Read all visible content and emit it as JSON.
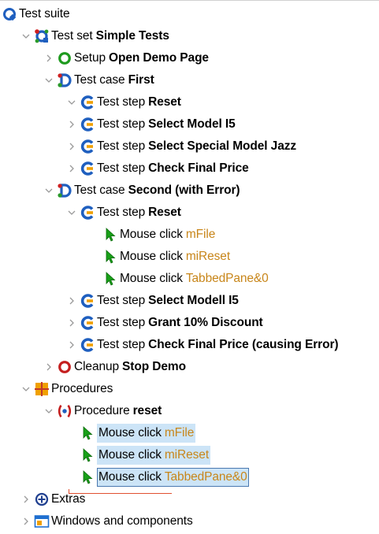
{
  "tree": {
    "nodes": [
      {
        "id": "n0",
        "level": 0,
        "expand": "none",
        "icon": "testsuite-icon",
        "kind": "Test suite",
        "name": "",
        "ref": "",
        "selected": false
      },
      {
        "id": "n1",
        "level": 1,
        "expand": "expanded",
        "icon": "testset-icon",
        "kind": "Test set",
        "name": "Simple Tests",
        "ref": "",
        "selected": false
      },
      {
        "id": "n2",
        "level": 2,
        "expand": "collapsed",
        "icon": "setup-icon",
        "kind": "Setup",
        "name": "Open Demo Page",
        "ref": "",
        "selected": false
      },
      {
        "id": "n3",
        "level": 2,
        "expand": "expanded",
        "icon": "testcase-icon",
        "kind": "Test case",
        "name": "First",
        "ref": "",
        "selected": false
      },
      {
        "id": "n4",
        "level": 3,
        "expand": "expanded",
        "icon": "teststep-icon",
        "kind": "Test step",
        "name": "Reset",
        "ref": "",
        "selected": false
      },
      {
        "id": "n5",
        "level": 3,
        "expand": "collapsed",
        "icon": "teststep-icon",
        "kind": "Test step",
        "name": "Select Model I5",
        "ref": "",
        "selected": false
      },
      {
        "id": "n6",
        "level": 3,
        "expand": "collapsed",
        "icon": "teststep-icon",
        "kind": "Test step",
        "name": "Select Special Model Jazz",
        "ref": "",
        "selected": false
      },
      {
        "id": "n7",
        "level": 3,
        "expand": "collapsed",
        "icon": "teststep-icon",
        "kind": "Test step",
        "name": "Check Final Price",
        "ref": "",
        "selected": false
      },
      {
        "id": "n8",
        "level": 2,
        "expand": "expanded",
        "icon": "testcase-icon",
        "kind": "Test case",
        "name": "Second (with Error)",
        "ref": "",
        "selected": false
      },
      {
        "id": "n9",
        "level": 3,
        "expand": "expanded",
        "icon": "teststep-icon",
        "kind": "Test step",
        "name": "Reset",
        "ref": "",
        "selected": false
      },
      {
        "id": "n10",
        "level": 4,
        "expand": "none",
        "icon": "mouse-click-icon",
        "kind": "Mouse click",
        "name": "",
        "ref": "mFile",
        "selected": false
      },
      {
        "id": "n11",
        "level": 4,
        "expand": "none",
        "icon": "mouse-click-icon",
        "kind": "Mouse click",
        "name": "",
        "ref": "miReset",
        "selected": false
      },
      {
        "id": "n12",
        "level": 4,
        "expand": "none",
        "icon": "mouse-click-icon",
        "kind": "Mouse click",
        "name": "",
        "ref": "TabbedPane&0",
        "selected": false
      },
      {
        "id": "n13",
        "level": 3,
        "expand": "collapsed",
        "icon": "teststep-icon",
        "kind": "Test step",
        "name": "Select Modell I5",
        "ref": "",
        "selected": false
      },
      {
        "id": "n14",
        "level": 3,
        "expand": "collapsed",
        "icon": "teststep-icon",
        "kind": "Test step",
        "name": "Grant 10% Discount",
        "ref": "",
        "selected": false
      },
      {
        "id": "n15",
        "level": 3,
        "expand": "collapsed",
        "icon": "teststep-icon",
        "kind": "Test step",
        "name": "Check Final Price (causing Error)",
        "ref": "",
        "selected": false
      },
      {
        "id": "n16",
        "level": 2,
        "expand": "collapsed",
        "icon": "cleanup-icon",
        "kind": "Cleanup",
        "name": "Stop Demo",
        "ref": "",
        "selected": false
      },
      {
        "id": "n17",
        "level": 1,
        "expand": "expanded",
        "icon": "procedures-icon",
        "kind": "Procedures",
        "name": "",
        "ref": "",
        "selected": false
      },
      {
        "id": "n18",
        "level": 2,
        "expand": "expanded",
        "icon": "procedure-icon",
        "kind": "Procedure",
        "name": "reset",
        "ref": "",
        "selected": false
      },
      {
        "id": "n19",
        "level": 3,
        "expand": "none",
        "icon": "mouse-click-icon",
        "kind": "Mouse click",
        "name": "",
        "ref": "mFile",
        "selected": true
      },
      {
        "id": "n20",
        "level": 3,
        "expand": "none",
        "icon": "mouse-click-icon",
        "kind": "Mouse click",
        "name": "",
        "ref": "miReset",
        "selected": true
      },
      {
        "id": "n21",
        "level": 3,
        "expand": "none",
        "icon": "mouse-click-icon",
        "kind": "Mouse click",
        "name": "",
        "ref": "TabbedPane&0",
        "selected": true,
        "focused": true
      },
      {
        "id": "n22",
        "level": 1,
        "expand": "collapsed",
        "icon": "extras-icon",
        "kind": "Extras",
        "name": "",
        "ref": "",
        "selected": false
      },
      {
        "id": "n23",
        "level": 1,
        "expand": "collapsed",
        "icon": "windows-components-icon",
        "kind": "Windows and components",
        "name": "",
        "ref": "",
        "selected": false
      }
    ]
  }
}
